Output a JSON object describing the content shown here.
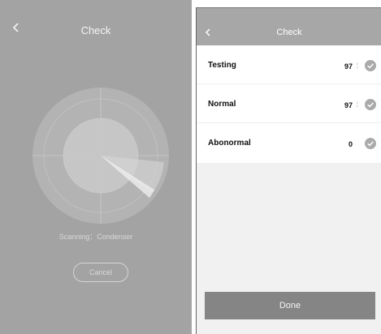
{
  "left_screen": {
    "title": "Check",
    "scanning_text": "Scanning：Condenser",
    "cancel_label": "Cancel",
    "icons": {
      "back": "chevron-left-icon",
      "radar": "radar-scan-icon"
    }
  },
  "right_screen": {
    "title": "Check",
    "rows": [
      {
        "label": "Testing",
        "value": "97",
        "status_icon": "check-circle-icon"
      },
      {
        "label": "Normal",
        "value": "97",
        "status_icon": "check-circle-icon"
      },
      {
        "label": "Abonormal",
        "value": "0",
        "status_icon": "check-circle-icon"
      }
    ],
    "done_label": "Done",
    "icons": {
      "back": "chevron-left-icon"
    }
  },
  "colors": {
    "left_background": "#a3a3a3",
    "right_header": "#a7a7a7",
    "done_button": "#858585",
    "check_circle": "#aaaaaa"
  }
}
